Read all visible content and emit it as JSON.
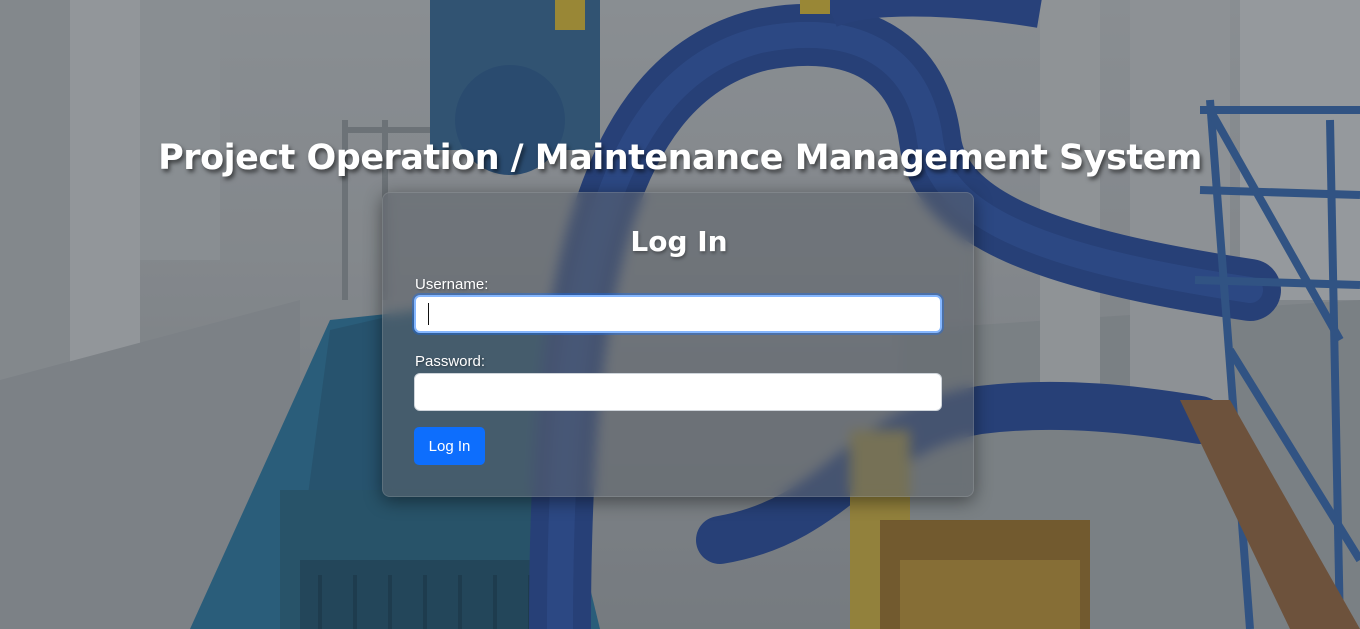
{
  "page": {
    "title": "Project Operation / Maintenance Management System"
  },
  "login": {
    "heading": "Log In",
    "username_label": "Username:",
    "username_value": "",
    "password_label": "Password:",
    "password_value": "",
    "submit_label": "Log In"
  },
  "colors": {
    "primary_button": "#0d6efd",
    "focus_ring": "#86b7fe",
    "text_light": "#ffffff"
  }
}
